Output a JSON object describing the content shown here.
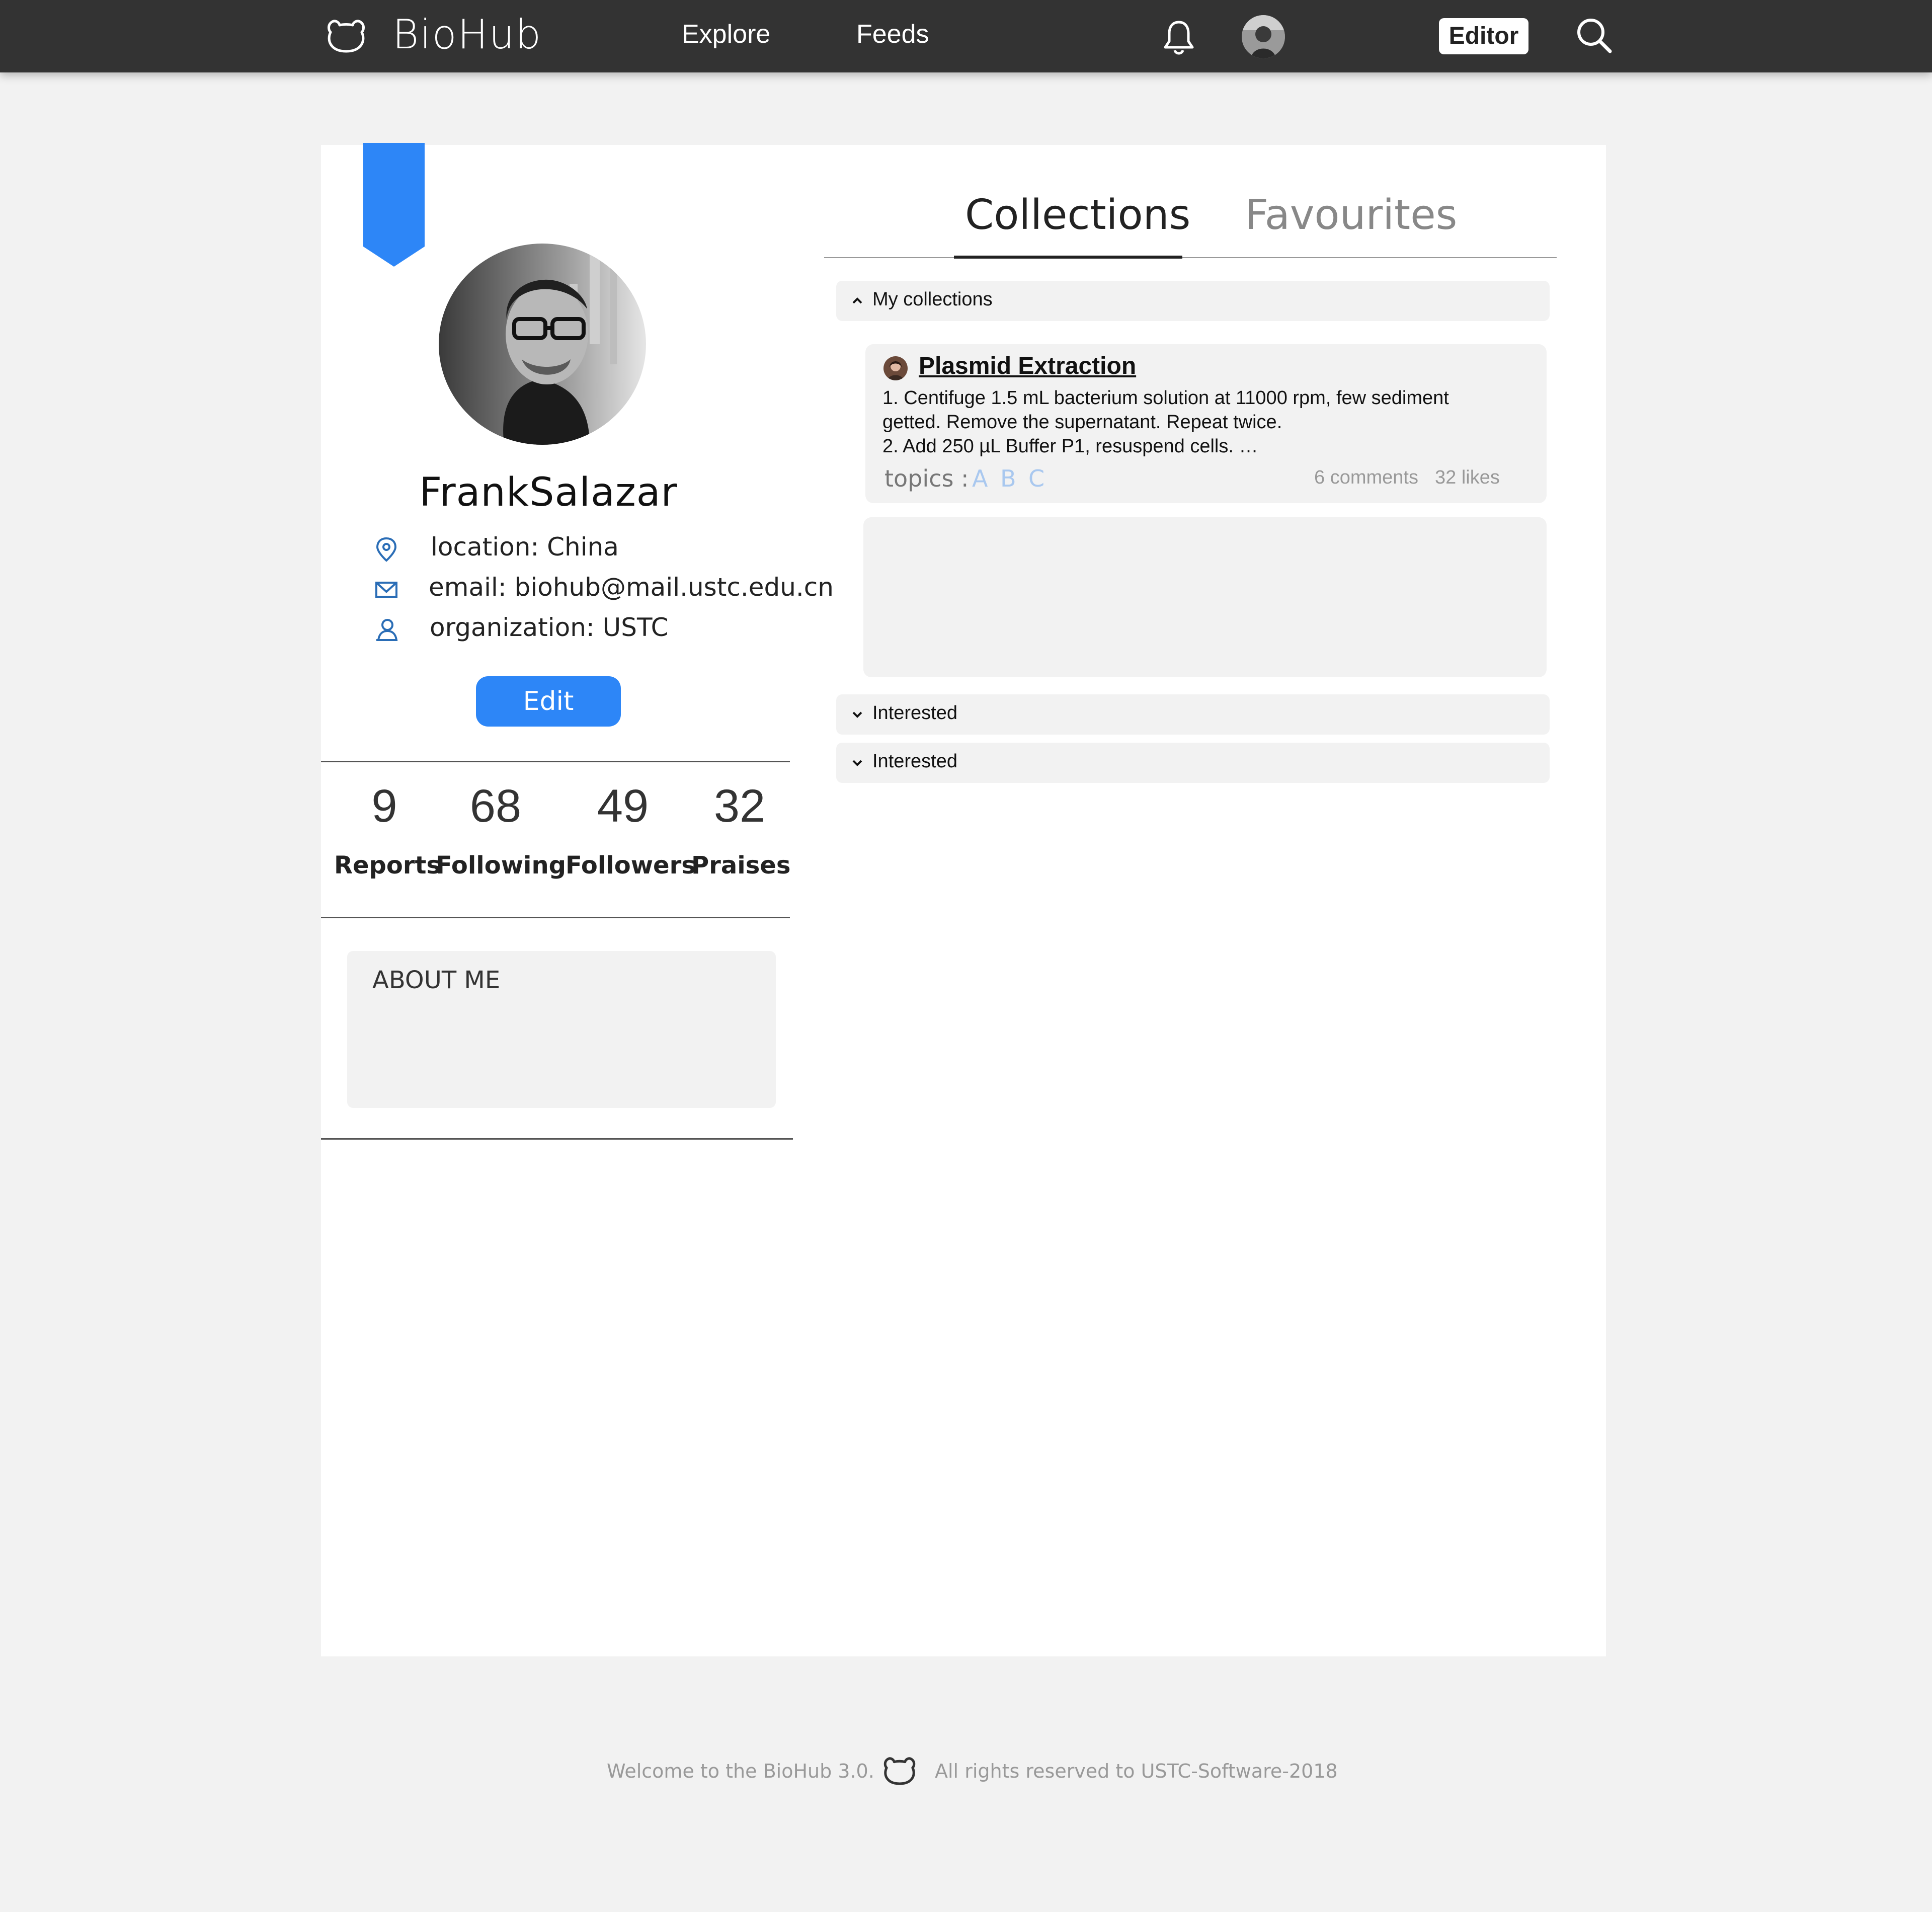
{
  "nav": {
    "brand": "BioHub",
    "links": [
      "Explore",
      "Feeds"
    ],
    "editor_label": "Editor",
    "icons": [
      "bear-logo-icon",
      "bell-icon",
      "avatar",
      "search-icon"
    ]
  },
  "profile": {
    "name": "FrankSalazar",
    "location": "location: China",
    "email": "email: biohub@mail.ustc.edu.cn",
    "organization": "organization: USTC",
    "edit_label": "Edit",
    "stats": [
      {
        "value": "9",
        "label": "Reports"
      },
      {
        "value": "68",
        "label": "Following"
      },
      {
        "value": "49",
        "label": "Followers"
      },
      {
        "value": "32",
        "label": "Praises"
      }
    ],
    "about_title": "ABOUT ME"
  },
  "tabs": {
    "active": "Collections",
    "inactive": "Favourites"
  },
  "sections": {
    "my_collections": "My collections",
    "interested_1": "Interested",
    "interested_2": "Interested"
  },
  "post": {
    "title": "Plasmid Extraction",
    "line1": "1. Centifuge 1.5 mL bacterium solution at 11000 rpm, few sediment",
    "line2": "getted. Remove the supernatant. Repeat twice.",
    "line3": "2. Add 250 µL Buffer P1, resuspend cells. …",
    "topics_label": "topics :",
    "topics": [
      "A",
      "B",
      "C"
    ],
    "comments": "6 comments",
    "likes": "32 likes"
  },
  "footer": {
    "welcome": "Welcome to the BioHub 3.0.",
    "rights": "All rights reserved to USTC-Software-2018"
  },
  "colors": {
    "nav_bg": "#333333",
    "accent": "#2d86f7",
    "topic": "#a9c8ef",
    "panel": "#f2f2f2"
  }
}
